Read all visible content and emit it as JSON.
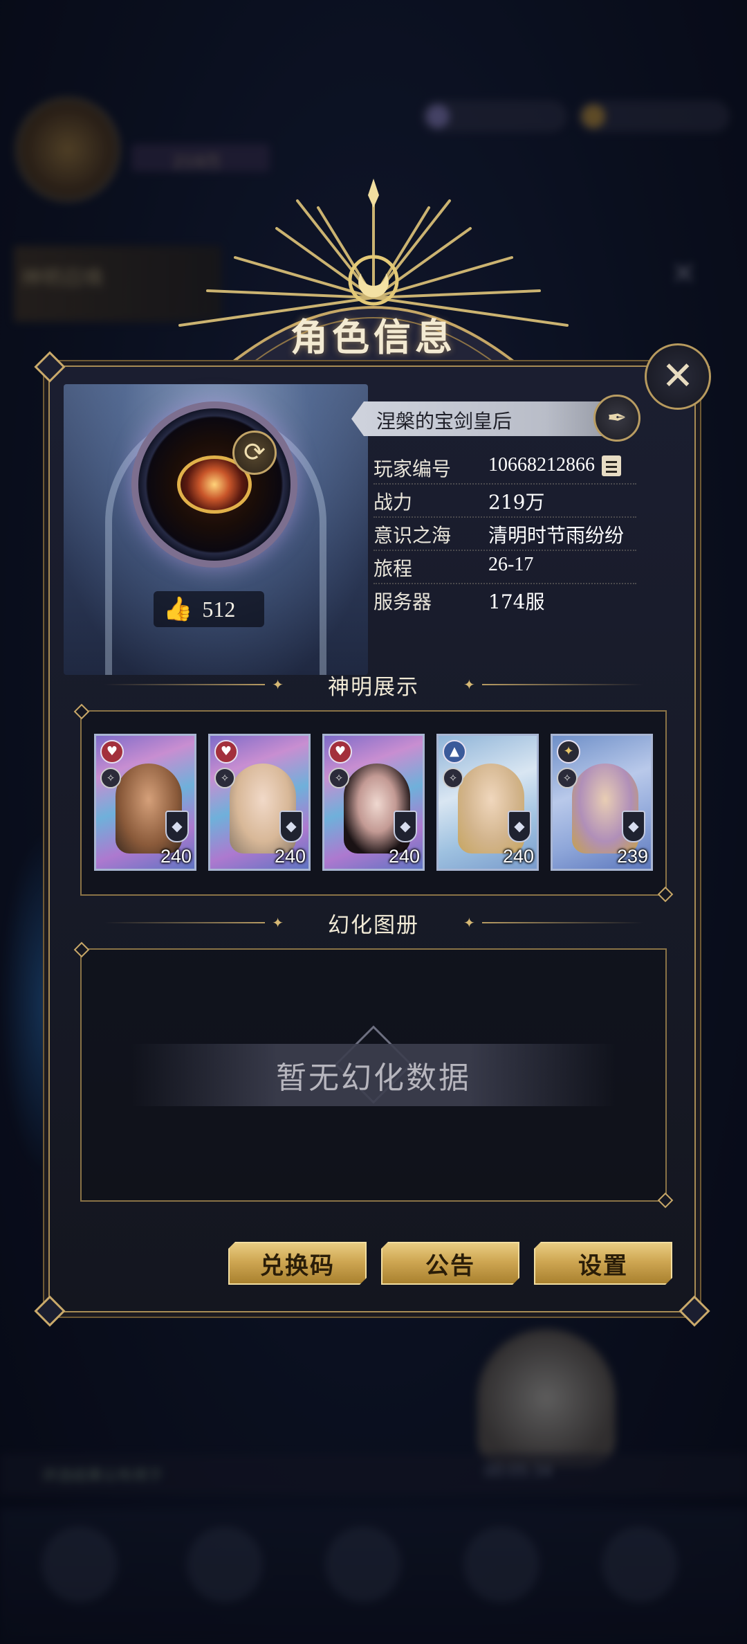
{
  "background": {
    "player_name": "完整的宝剑皇后",
    "power": "219万",
    "event_label": "神明召唤",
    "ticker_text": "评选结果公布将于",
    "ticker_time": "00:05:34"
  },
  "dialog": {
    "title": "角色信息",
    "player_name": "涅槃的宝剑皇后",
    "likes": "512",
    "info": [
      {
        "label": "玩家编号",
        "value": "10668212866"
      },
      {
        "label": "战力",
        "value": "219万"
      },
      {
        "label": "意识之海",
        "value": "清明时节雨纷纷"
      },
      {
        "label": "旅程",
        "value": "26-17"
      },
      {
        "label": "服务器",
        "value": "174服"
      }
    ],
    "section_showcase": "神明展示",
    "section_gallery": "幻化图册",
    "empty_gallery": "暂无幻化数据",
    "cards": [
      {
        "level": "240",
        "badge": "heart"
      },
      {
        "level": "240",
        "badge": "heart"
      },
      {
        "level": "240",
        "badge": "heart"
      },
      {
        "level": "240",
        "badge": "up"
      },
      {
        "level": "239",
        "badge": "star"
      }
    ],
    "buttons": {
      "redeem": "兑换码",
      "notice": "公告",
      "settings": "设置"
    }
  },
  "colors": {
    "gold": "#cfa753",
    "panel": "#1b1e30",
    "accent_frame": "#a88c55"
  }
}
